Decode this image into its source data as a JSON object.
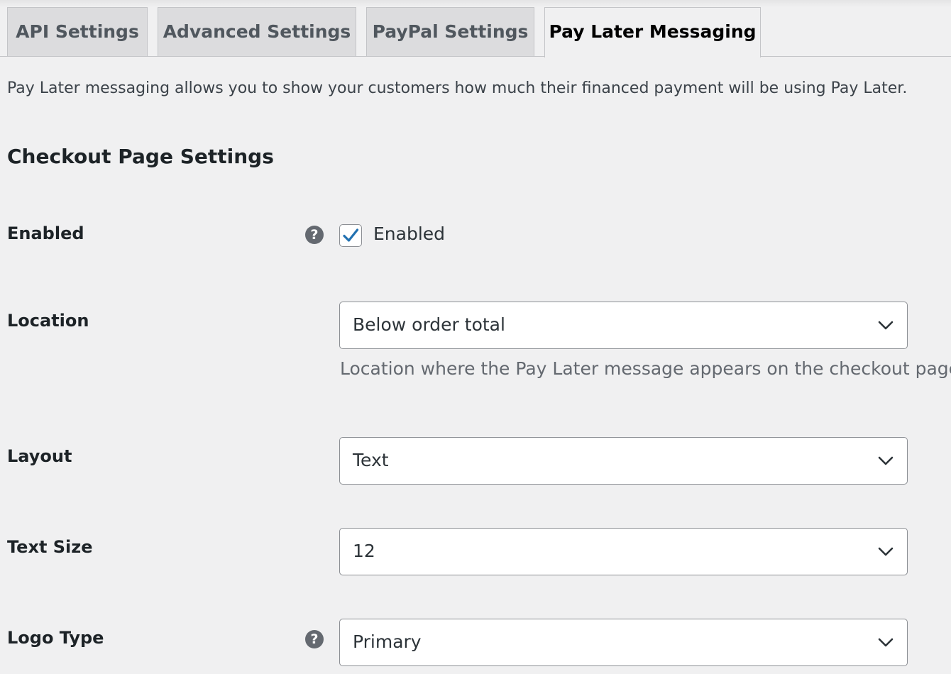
{
  "tabs": [
    {
      "label": "API Settings",
      "active": false
    },
    {
      "label": "Advanced Settings",
      "active": false
    },
    {
      "label": "PayPal Settings",
      "active": false
    },
    {
      "label": "Pay Later Messaging",
      "active": true
    }
  ],
  "intro_text": "Pay Later messaging allows you to show your customers how much their financed payment will be using Pay Later.",
  "section_title": "Checkout Page Settings",
  "fields": {
    "enabled": {
      "label": "Enabled",
      "checkbox_label": "Enabled",
      "checked": true,
      "has_help": true
    },
    "location": {
      "label": "Location",
      "value": "Below order total",
      "description": "Location where the Pay Later message appears on the checkout page"
    },
    "layout": {
      "label": "Layout",
      "value": "Text"
    },
    "text_size": {
      "label": "Text Size",
      "value": "12"
    },
    "logo_type": {
      "label": "Logo Type",
      "value": "Primary",
      "has_help": true
    }
  },
  "icons": {
    "help": "help-icon",
    "checkmark": "checkmark-icon",
    "dropdown": "chevron-down-icon"
  },
  "colors": {
    "accent": "#2271b1",
    "help_icon_bg": "#646970",
    "background": "#f0f0f1"
  }
}
